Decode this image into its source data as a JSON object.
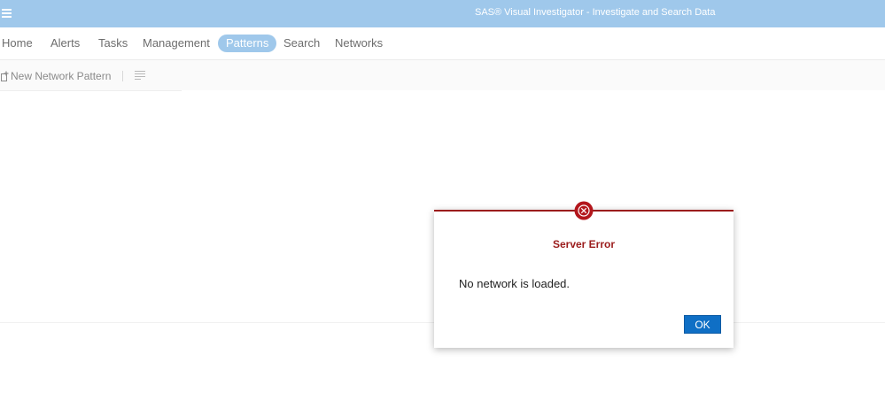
{
  "app": {
    "title": "SAS® Visual Investigator - Investigate and Search Data"
  },
  "nav": {
    "tabs": [
      {
        "label": "Home"
      },
      {
        "label": "Alerts"
      },
      {
        "label": "Tasks"
      },
      {
        "label": "Management"
      },
      {
        "label": "Patterns",
        "active": true
      },
      {
        "label": "Search"
      },
      {
        "label": "Networks"
      }
    ]
  },
  "toolbar": {
    "new_pattern_label": "New Network Pattern"
  },
  "dialog": {
    "title": "Server Error",
    "message": "No network is loaded.",
    "ok_label": "OK"
  },
  "colors": {
    "header_bg": "#9fc8eb",
    "error": "#9b1c1c",
    "primary_button": "#0f6fc5"
  }
}
